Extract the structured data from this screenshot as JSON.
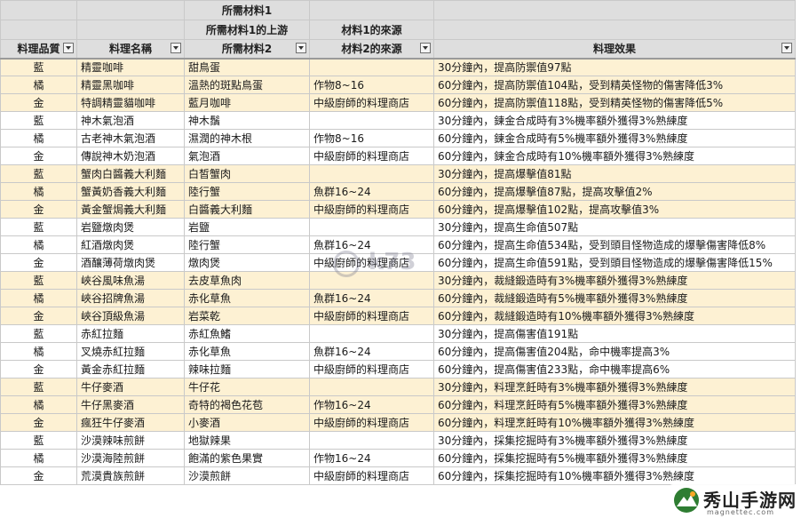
{
  "header": {
    "row1": [
      "",
      "",
      "所需材料1",
      "",
      ""
    ],
    "row2": [
      "",
      "",
      "所需材料1的上游",
      "材料1的來源",
      ""
    ],
    "row3": [
      "料理品質",
      "料理名稱",
      "所需材料2",
      "材料2的來源",
      "料理效果"
    ]
  },
  "rows": [
    {
      "band": true,
      "quality": "藍",
      "name": "精靈咖啡",
      "mat": "甜鳥蛋",
      "src": "",
      "effect": "30分鐘內，提高防禦值97點"
    },
    {
      "band": true,
      "quality": "橘",
      "name": "精靈黑咖啡",
      "mat": "溫熱的斑點鳥蛋",
      "src": "作物8~16",
      "effect": "60分鐘內，提高防禦值104點，受到精英怪物的傷害降低3%"
    },
    {
      "band": true,
      "quality": "金",
      "name": "特調精靈貓咖啡",
      "mat": "藍月咖啡",
      "src": "中級廚師的料理商店",
      "effect": "60分鐘內，提高防禦值118點，受到精英怪物的傷害降低5%"
    },
    {
      "band": false,
      "quality": "藍",
      "name": "神木氣泡酒",
      "mat": "神木鬚",
      "src": "",
      "effect": "30分鐘內，鍊金合成時有3%機率額外獲得3%熟練度"
    },
    {
      "band": false,
      "quality": "橘",
      "name": "古老神木氣泡酒",
      "mat": "濕潤的神木根",
      "src": "作物8~16",
      "effect": "60分鐘內，鍊金合成時有5%機率額外獲得3%熟練度"
    },
    {
      "band": false,
      "quality": "金",
      "name": "傳說神木奶泡酒",
      "mat": "氣泡酒",
      "src": "中級廚師的料理商店",
      "effect": "60分鐘內，鍊金合成時有10%機率額外獲得3%熟練度"
    },
    {
      "band": true,
      "quality": "藍",
      "name": "蟹肉白醬義大利麵",
      "mat": "白皙蟹肉",
      "src": "",
      "effect": "30分鐘內，提高爆擊值81點"
    },
    {
      "band": true,
      "quality": "橘",
      "name": "蟹黃奶香義大利麵",
      "mat": "陸行蟹",
      "src": "魚群16~24",
      "effect": "60分鐘內，提高爆擊值87點，提高攻擊值2%"
    },
    {
      "band": true,
      "quality": "金",
      "name": "黃金蟹焗義大利麵",
      "mat": "白醬義大利麵",
      "src": "中級廚師的料理商店",
      "effect": "60分鐘內，提高爆擊值102點，提高攻擊值3%"
    },
    {
      "band": false,
      "quality": "藍",
      "name": "岩鹽燉肉煲",
      "mat": "岩鹽",
      "src": "",
      "effect": "30分鐘內，提高生命值507點"
    },
    {
      "band": false,
      "quality": "橘",
      "name": "紅酒燉肉煲",
      "mat": "陸行蟹",
      "src": "魚群16~24",
      "effect": "60分鐘內，提高生命值534點，受到頭目怪物造成的爆擊傷害降低8%"
    },
    {
      "band": false,
      "quality": "金",
      "name": "酒釀薄荷燉肉煲",
      "mat": "燉肉煲",
      "src": "中級廚師的料理商店",
      "effect": "60分鐘內，提高生命值591點，受到頭目怪物造成的爆擊傷害降低15%"
    },
    {
      "band": true,
      "quality": "藍",
      "name": "峽谷風味魚湯",
      "mat": "去皮草魚肉",
      "src": "",
      "effect": "30分鐘內，裁縫鍛造時有3%機率額外獲得3%熟練度"
    },
    {
      "band": true,
      "quality": "橘",
      "name": "峽谷招牌魚湯",
      "mat": "赤化草魚",
      "src": "魚群16~24",
      "effect": "60分鐘內，裁縫鍛造時有5%機率額外獲得3%熟練度"
    },
    {
      "band": true,
      "quality": "金",
      "name": "峽谷頂級魚湯",
      "mat": "岩菜乾",
      "src": "中級廚師的料理商店",
      "effect": "60分鐘內，裁縫鍛造時有10%機率額外獲得3%熟練度"
    },
    {
      "band": false,
      "quality": "藍",
      "name": "赤紅拉麵",
      "mat": "赤紅魚鰭",
      "src": "",
      "effect": "30分鐘內，提高傷害值191點"
    },
    {
      "band": false,
      "quality": "橘",
      "name": "叉燒赤紅拉麵",
      "mat": "赤化草魚",
      "src": "魚群16~24",
      "effect": "60分鐘內，提高傷害值204點，命中機率提高3%"
    },
    {
      "band": false,
      "quality": "金",
      "name": "黃金赤紅拉麵",
      "mat": "辣味拉麵",
      "src": "中級廚師的料理商店",
      "effect": "60分鐘內，提高傷害值233點，命中機率提高6%"
    },
    {
      "band": true,
      "quality": "藍",
      "name": "牛仔麥酒",
      "mat": "牛仔花",
      "src": "",
      "effect": "30分鐘內，料理烹飪時有3%機率額外獲得3%熟練度"
    },
    {
      "band": true,
      "quality": "橘",
      "name": "牛仔黑麥酒",
      "mat": "奇特的褐色花苞",
      "src": "作物16~24",
      "effect": "60分鐘內，料理烹飪時有5%機率額外獲得3%熟練度"
    },
    {
      "band": true,
      "quality": "金",
      "name": "瘋狂牛仔麥酒",
      "mat": "小麥酒",
      "src": "中級廚師的料理商店",
      "effect": "60分鐘內，料理烹飪時有10%機率額外獲得3%熟練度"
    },
    {
      "band": false,
      "quality": "藍",
      "name": "沙漠辣味煎餅",
      "mat": "地獄辣果",
      "src": "",
      "effect": "30分鐘內，採集挖掘時有3%機率額外獲得3%熟練度"
    },
    {
      "band": false,
      "quality": "橘",
      "name": "沙漠海陸煎餅",
      "mat": "飽滿的紫色果實",
      "src": "作物16~24",
      "effect": "60分鐘內，採集挖掘時有5%機率額外獲得3%熟練度"
    },
    {
      "band": false,
      "quality": "金",
      "name": "荒漠貴族煎餅",
      "mat": "沙漠煎餅",
      "src": "中級廚師的料理商店",
      "effect": "60分鐘內，採集挖掘時有10%機率額外獲得3%熟練度"
    }
  ],
  "watermark": "k73",
  "site_logo": {
    "name": "秀山手游网",
    "url": "magnettec.com"
  }
}
